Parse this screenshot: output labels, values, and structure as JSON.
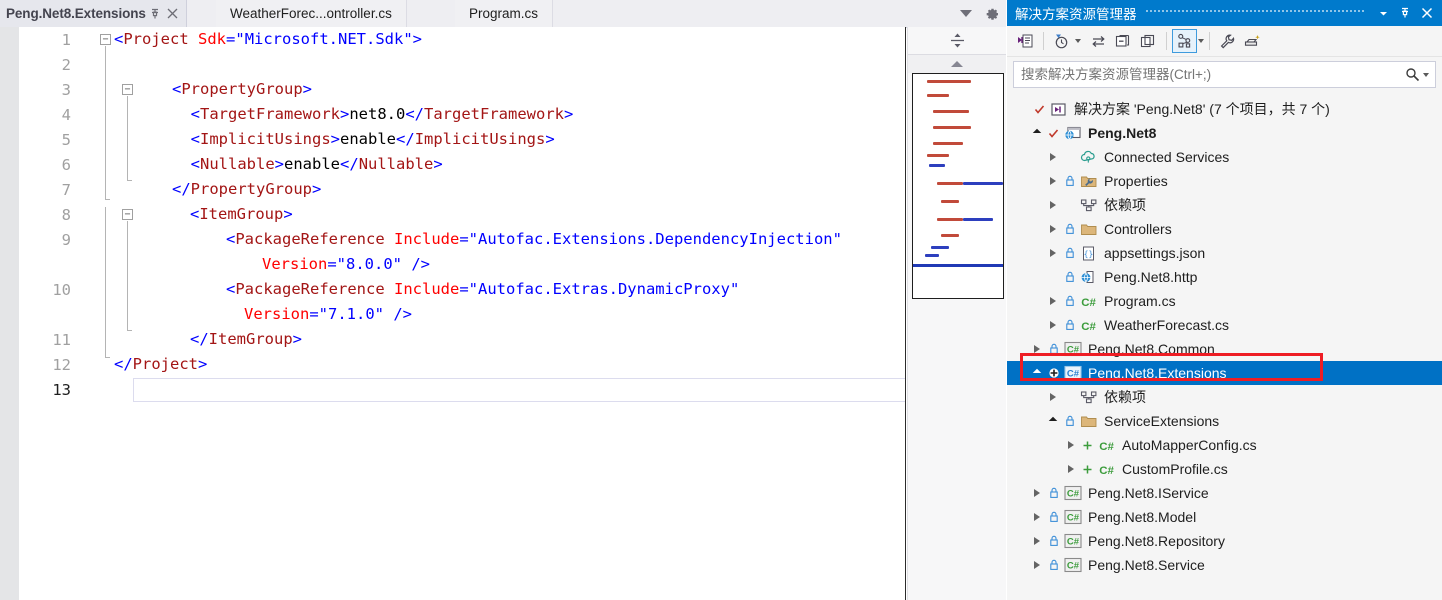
{
  "editor": {
    "tabs": [
      {
        "label": "Peng.Net8.Extensions",
        "active": true,
        "pin_icon": "pin-icon",
        "close_icon": "close-icon"
      },
      {
        "label": "WeatherForec...ontroller.cs",
        "active": false
      },
      {
        "label": "Program.cs",
        "active": false
      }
    ],
    "tabstrip_controls": [
      {
        "name": "tab-overflow-chevron-icon",
        "label": "▾"
      },
      {
        "name": "tab-settings-gear-icon",
        "label": "gear-icon"
      }
    ],
    "lines": [
      {
        "num": "1",
        "cur": false
      },
      {
        "num": "2",
        "cur": false
      },
      {
        "num": "3",
        "cur": false
      },
      {
        "num": "4",
        "cur": false
      },
      {
        "num": "5",
        "cur": false
      },
      {
        "num": "6",
        "cur": false
      },
      {
        "num": "7",
        "cur": false
      },
      {
        "num": "8",
        "cur": false
      },
      {
        "num": "9",
        "cur": false
      },
      {
        "num": "10",
        "cur": false
      },
      {
        "num": "11",
        "cur": false
      },
      {
        "num": "12",
        "cur": false
      },
      {
        "num": "13",
        "cur": true
      }
    ],
    "code": {
      "l1": "<Project Sdk=\"Microsoft.NET.Sdk\">",
      "l3": "  <PropertyGroup>",
      "l4": "    <TargetFramework>net8.0</TargetFramework>",
      "l5": "    <ImplicitUsings>enable</ImplicitUsings>",
      "l6": "    <Nullable>enable</Nullable>",
      "l7": "  </PropertyGroup>",
      "l8": "    <ItemGroup>",
      "l9a": "      <PackageReference Include=\"Autofac.Extensions.DependencyInjection\"",
      "l9b": "        Version=\"8.0.0\" />",
      "l10a": "      <PackageReference Include=\"Autofac.Extras.DynamicProxy\"",
      "l10b": "        Version=\"7.1.0\" />",
      "l11": "    </ItemGroup>",
      "l12": "</Project>"
    },
    "tokens": {
      "project": "Project",
      "sdk_attr": "Sdk",
      "sdk_val": "\"Microsoft.NET.Sdk\"",
      "propertygroup": "PropertyGroup",
      "targetframework": "TargetFramework",
      "targetframework_val": "net8.0",
      "implicitusings": "ImplicitUsings",
      "implicitusings_val": "enable",
      "nullable": "Nullable",
      "nullable_val": "enable",
      "itemgroup": "ItemGroup",
      "packagereference": "PackageReference",
      "include_attr": "Include",
      "include_val1": "\"Autofac.Extensions.DependencyInjection\"",
      "include_val2": "\"Autofac.Extras.DynamicProxy\"",
      "version_attr": "Version",
      "version_val1": "\"8.0.0\"",
      "version_val2": "\"7.1.0\""
    },
    "scroll": {
      "splitter_icon": "splitter-icon",
      "scrollup_icon": "scroll-up-icon"
    },
    "colors": {
      "tag": "#0000ff",
      "element": "#a31515",
      "attribute": "#ff0000",
      "value": "#0000ff",
      "text": "#000000",
      "accent": "#007acc",
      "highlight": "#0071c5",
      "redbox": "#ee1d24"
    }
  },
  "solution_explorer": {
    "title": "解决方案资源管理器",
    "title_buttons": [
      {
        "name": "dropdown-icon",
        "label": "▾"
      },
      {
        "name": "pin-icon",
        "label": "pin"
      },
      {
        "name": "close-icon",
        "label": "✕"
      }
    ],
    "toolbar": [
      {
        "name": "sync-with-active-document-button",
        "icon": "sync-document-icon"
      },
      {
        "name": "pending-changes-filter-button",
        "icon": "clock-filter-icon",
        "caret": true
      },
      {
        "name": "refresh-button",
        "icon": "refresh-arrows-icon"
      },
      {
        "name": "collapse-all-button",
        "icon": "collapse-all-icon"
      },
      {
        "name": "show-all-files-button",
        "icon": "show-all-files-icon"
      },
      {
        "name": "view-selector-button",
        "icon": "solution-view-icon",
        "caret": true,
        "selected": true
      },
      {
        "name": "properties-button",
        "icon": "wrench-icon"
      },
      {
        "name": "preview-selected-items-button",
        "icon": "preview-icon"
      }
    ],
    "search_placeholder": "搜索解决方案资源管理器(Ctrl+;)",
    "search_value": "",
    "search_icon": "magnifier-icon",
    "search_caret": "▾",
    "tree": [
      {
        "label": "解决方案 'Peng.Net8' (7 个项目，共 7 个)",
        "indent": 0,
        "expander": "none",
        "check": true,
        "icon": "solution-icon",
        "bold": false,
        "sel": false
      },
      {
        "label": "Peng.Net8",
        "indent": 1,
        "expander": "down",
        "check": true,
        "icon": "web-project-icon",
        "bold": true,
        "sel": false
      },
      {
        "label": "Connected Services",
        "indent": 2,
        "expander": "right",
        "lock": false,
        "icon": "connected-services-icon",
        "bold": false,
        "sel": false
      },
      {
        "label": "Properties",
        "indent": 2,
        "expander": "right",
        "lock": true,
        "icon": "properties-folder-icon",
        "bold": false,
        "sel": false
      },
      {
        "label": "依赖项",
        "indent": 2,
        "expander": "right",
        "lock": false,
        "icon": "dependencies-icon",
        "bold": false,
        "sel": false
      },
      {
        "label": "Controllers",
        "indent": 2,
        "expander": "right",
        "lock": true,
        "icon": "folder-icon",
        "bold": false,
        "sel": false
      },
      {
        "label": "appsettings.json",
        "indent": 2,
        "expander": "right",
        "lock": true,
        "icon": "json-file-icon",
        "bold": false,
        "sel": false
      },
      {
        "label": "Peng.Net8.http",
        "indent": 2,
        "expander": "none",
        "lock": true,
        "icon": "http-file-icon",
        "bold": false,
        "sel": false
      },
      {
        "label": "Program.cs",
        "indent": 2,
        "expander": "right",
        "lock": true,
        "icon": "csharp-file-icon",
        "bold": false,
        "sel": false
      },
      {
        "label": "WeatherForecast.cs",
        "indent": 2,
        "expander": "right",
        "lock": true,
        "icon": "csharp-file-icon",
        "bold": false,
        "sel": false
      },
      {
        "label": "Peng.Net8.Common",
        "indent": 1,
        "expander": "right",
        "lock": true,
        "icon": "csharp-project-icon",
        "bold": false,
        "sel": false
      },
      {
        "label": "Peng.Net8.Extensions",
        "indent": 1,
        "expander": "down",
        "plus": true,
        "icon": "csharp-project-icon",
        "bold": false,
        "sel": true
      },
      {
        "label": "依赖项",
        "indent": 2,
        "expander": "right",
        "lock": false,
        "icon": "dependencies-icon",
        "bold": false,
        "sel": false
      },
      {
        "label": "ServiceExtensions",
        "indent": 2,
        "expander": "down",
        "lock": true,
        "icon": "folder-icon",
        "bold": false,
        "sel": false
      },
      {
        "label": "AutoMapperConfig.cs",
        "indent": 3,
        "expander": "right",
        "plus": true,
        "icon": "csharp-file-icon",
        "bold": false,
        "sel": false
      },
      {
        "label": "CustomProfile.cs",
        "indent": 3,
        "expander": "right",
        "plus": true,
        "icon": "csharp-file-icon",
        "bold": false,
        "sel": false
      },
      {
        "label": "Peng.Net8.IService",
        "indent": 1,
        "expander": "right",
        "lock": true,
        "icon": "csharp-project-icon",
        "bold": false,
        "sel": false
      },
      {
        "label": "Peng.Net8.Model",
        "indent": 1,
        "expander": "right",
        "lock": true,
        "icon": "csharp-project-icon",
        "bold": false,
        "sel": false
      },
      {
        "label": "Peng.Net8.Repository",
        "indent": 1,
        "expander": "right",
        "lock": true,
        "icon": "csharp-project-icon",
        "bold": false,
        "sel": false
      },
      {
        "label": "Peng.Net8.Service",
        "indent": 1,
        "expander": "right",
        "lock": true,
        "icon": "csharp-project-icon",
        "bold": false,
        "sel": false
      }
    ]
  }
}
